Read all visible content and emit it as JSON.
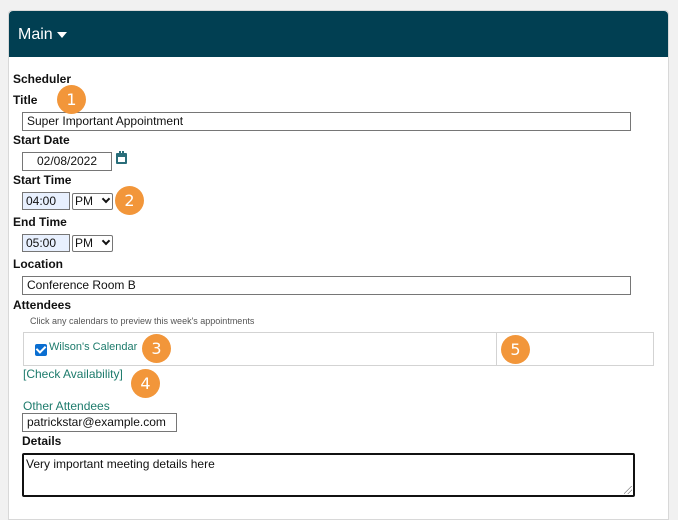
{
  "header": {
    "title": "Main"
  },
  "form": {
    "section_label": "Scheduler",
    "title_label": "Title",
    "title_value": "Super Important Appointment",
    "start_date_label": "Start Date",
    "start_date_value": "02/08/2022",
    "start_time_label": "Start Time",
    "start_time_value": "04:00",
    "start_ampm": "PM",
    "end_time_label": "End Time",
    "end_time_value": "05:00",
    "end_ampm": "PM",
    "location_label": "Location",
    "location_value": "Conference Room B",
    "attendees_label": "Attendees",
    "attendees_hint": "Click any calendars to preview this week's appointments",
    "calendars": [
      {
        "label": "Wilson's Calendar",
        "checked": true
      }
    ],
    "check_availability": "[Check Availability]",
    "other_attendees_label": "Other Attendees",
    "other_attendees_value": "patrickstar@example.com",
    "details_label": "Details",
    "details_value": "Very important meeting details here"
  },
  "annotations": [
    "1",
    "2",
    "3",
    "4",
    "5"
  ],
  "colors": {
    "header_bg": "#013f52",
    "link": "#1d7b6c",
    "badge": "#f2963a",
    "checkbox": "#0a6ed1"
  },
  "icons": [
    "chevron-down-icon",
    "calendar-icon",
    "checkbox-checked-icon",
    "resize-grip-icon"
  ]
}
